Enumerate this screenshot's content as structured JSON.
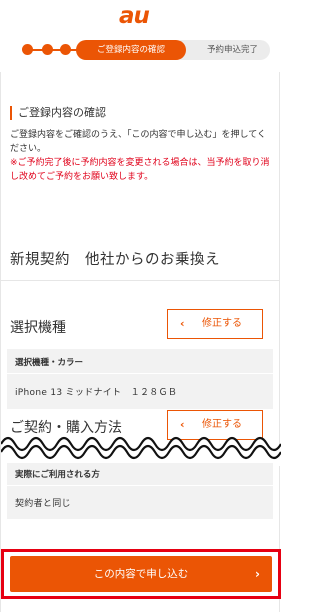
{
  "header": {
    "logo": "au",
    "steps": {
      "current": "ご登録内容の確認",
      "next": "予約申込完了"
    }
  },
  "confirm": {
    "heading": "ご登録内容の確認",
    "intro": "ご登録内容をご確認のうえ、「この内容で申し込む」を押してください。",
    "notice": "※ご予約完了後に予約内容を変更される場合は、当予約を取り消し改めてご予約をお願い致します。"
  },
  "contract_type": "新規契約　他社からのお乗換え",
  "device": {
    "title": "選択機種",
    "edit_label": "修正する",
    "field_label": "選択機種・カラー",
    "field_value": "iPhone 13 ミッドナイト　１２８ＧＢ"
  },
  "purchase": {
    "title": "ご契約・購入方法",
    "edit_label": "修正する",
    "user_label": "実際にご利用される方",
    "user_value": "契約者と同じ"
  },
  "submit": {
    "label": "この内容で申し込む"
  },
  "colors": {
    "brand": "#eb5505",
    "highlight_frame": "#e60012",
    "notice_red": "#e0001a"
  }
}
